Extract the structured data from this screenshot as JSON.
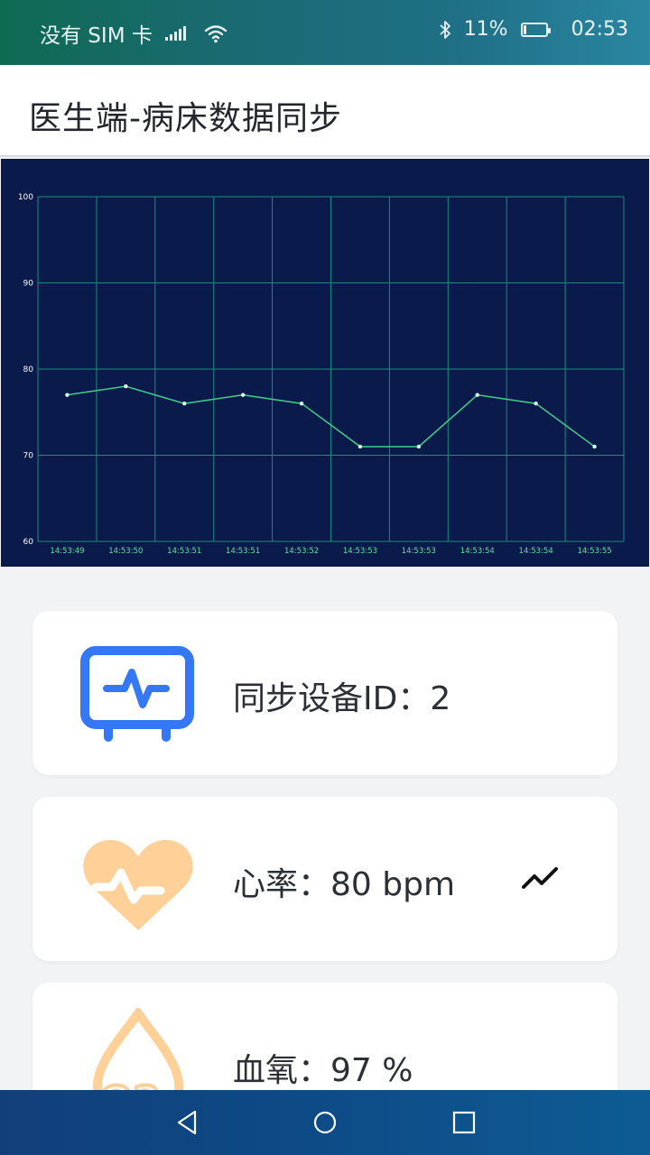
{
  "status_bar": {
    "carrier": "没有 SIM 卡",
    "battery_percent": "11%",
    "battery_level": 0.11,
    "time": "02:53"
  },
  "header": {
    "title": "医生端-病床数据同步"
  },
  "chart_data": {
    "type": "line",
    "title": "",
    "xlabel": "",
    "ylabel": "",
    "ylim": [
      60,
      100
    ],
    "y_ticks": [
      100,
      90,
      80,
      70,
      60
    ],
    "grid": true,
    "categories": [
      "14:53:49",
      "14:53:50",
      "14:53:51",
      "14:53:51",
      "14:53:52",
      "14:53:53",
      "14:53:53",
      "14:53:54",
      "14:53:54",
      "14:53:55"
    ],
    "values": [
      77,
      78,
      76,
      77,
      76,
      71,
      71,
      77,
      76,
      71
    ],
    "colors": {
      "background": "#0a1a4a",
      "grid": "#1f8a7f",
      "line": "#3fd08c",
      "point": "#d8ffe6",
      "tick_text": "#ffffff",
      "xtick_text": "#5fe0a0"
    }
  },
  "cards": {
    "device": {
      "label": "同步设备ID：2",
      "icon": "monitor-pulse-icon",
      "color": "#3478f6"
    },
    "heart_rate": {
      "label": "心率：80 bpm",
      "icon": "heart-pulse-icon",
      "color": "#ffd199",
      "trend_icon": "trend-icon"
    },
    "blood_oxygen": {
      "label": "血氧：97 %",
      "icon": "oxygen-drop-icon",
      "color": "#ffd199"
    }
  },
  "nav": {
    "back": "back-icon",
    "home": "home-icon",
    "recent": "recent-apps-icon"
  }
}
